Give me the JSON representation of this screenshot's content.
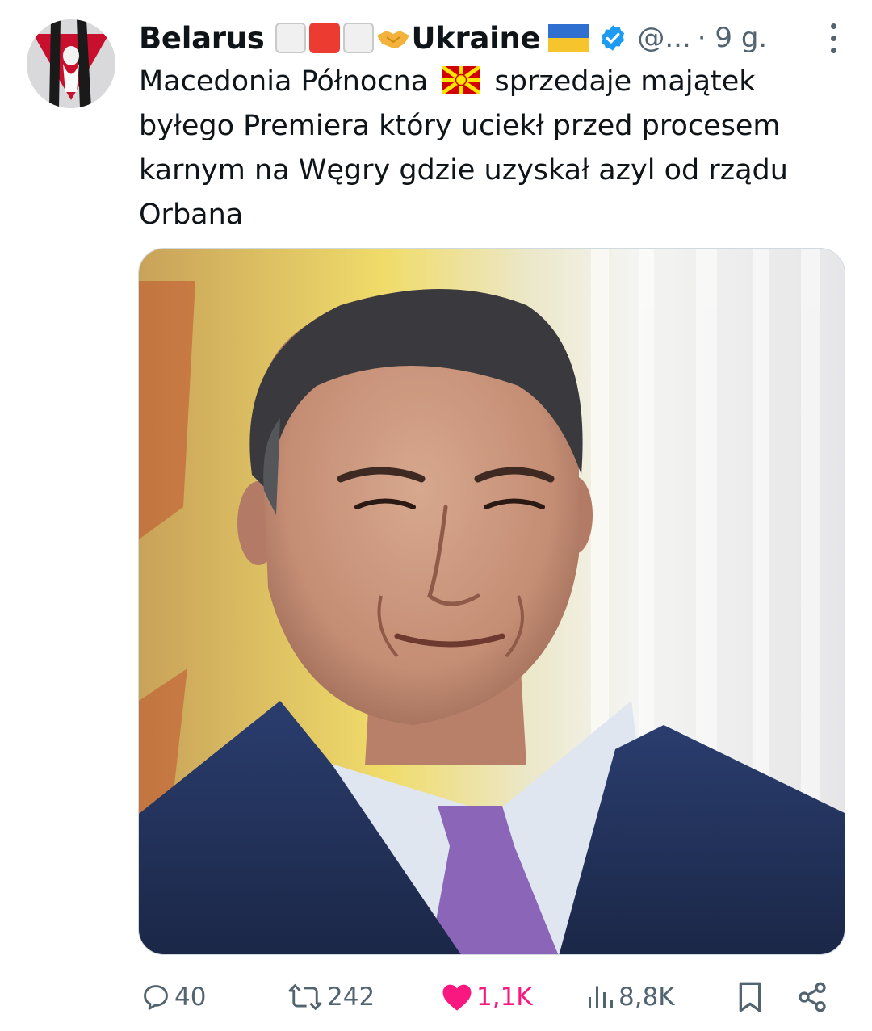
{
  "author": {
    "name": "Belarus",
    "flag_middle": "Ukraine",
    "handle": "@...",
    "time": "· 9 g."
  },
  "tweet": {
    "lines": [
      [
        "Macedonia Północna",
        "sprzedaje majątek"
      ],
      "byłego Premiera który uciekł przed procesem",
      "karnym na Węgry gdzie uzyskał azyl od rządu",
      "Orbana"
    ]
  },
  "actions": {
    "replies": "40",
    "retweets": "242",
    "likes": "1,1K",
    "views": "8,8K"
  },
  "colors": {
    "text": "#0f1419",
    "secondary": "#536471",
    "like": "#f91880",
    "verified": "#1d9bf0"
  },
  "icons": [
    "more-icon",
    "verified-icon",
    "reply-icon",
    "retweet-icon",
    "like-icon",
    "views-icon",
    "bookmark-icon",
    "share-icon"
  ]
}
